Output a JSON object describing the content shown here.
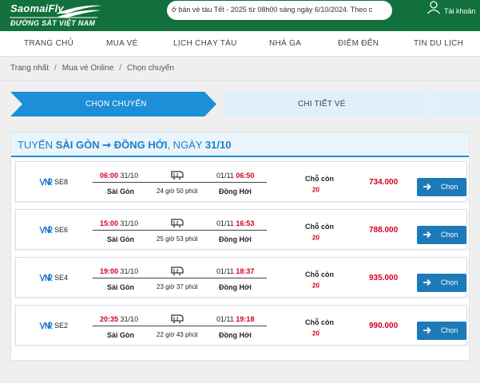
{
  "header": {
    "logo_text": "SaomaiFly",
    "logo_subtext": "ĐƯỜNG SẮT VIỆT NAM",
    "ticker": "ở bán vé tàu Tết - 2025 từ 08h00 sáng ngày 6/10/2024. Theo c",
    "account_label": "Tài khoản",
    "brand_color": "#11703c"
  },
  "nav": {
    "items": [
      "TRANG CHỦ",
      "MUA VÉ",
      "LỊCH CHẠY TÀU",
      "NHÀ GA",
      "ĐIỂM ĐẾN",
      "TIN DU LỊCH"
    ]
  },
  "breadcrumb": [
    "Trang nhất",
    "Mua vé Online",
    "Chọn chuyến"
  ],
  "steps": [
    "CHỌN CHUYẾN",
    "CHI TIẾT VÉ"
  ],
  "route": {
    "prefix": "TUYẾN",
    "from": "SÀI GÒN",
    "arrow": "➞",
    "to": "ĐỒNG HỚI",
    "date_prefix": ", NGÀY",
    "date": "31/10"
  },
  "trips": [
    {
      "code": "SE8",
      "dep_time": "06:00",
      "dep_date": "31/10",
      "arr_date": "01/11",
      "arr_time": "06:50",
      "dep_station": "Sài Gòn",
      "arr_station": "Đồng Hới",
      "duration": "24 giờ 50 phút",
      "seat_label": "Chỗ còn",
      "seats": "20",
      "price": "734.000",
      "button": "Chọn"
    },
    {
      "code": "SE6",
      "dep_time": "15:00",
      "dep_date": "31/10",
      "arr_date": "01/11",
      "arr_time": "16:53",
      "dep_station": "Sài Gòn",
      "arr_station": "Đồng Hới",
      "duration": "25 giờ 53 phút",
      "seat_label": "Chỗ còn",
      "seats": "20",
      "price": "788.000",
      "button": "Chọn"
    },
    {
      "code": "SE4",
      "dep_time": "19:00",
      "dep_date": "31/10",
      "arr_date": "01/11",
      "arr_time": "18:37",
      "dep_station": "Sài Gòn",
      "arr_station": "Đồng Hới",
      "duration": "23 giờ 37 phút",
      "seat_label": "Chỗ còn",
      "seats": "20",
      "price": "935.000",
      "button": "Chọn"
    },
    {
      "code": "SE2",
      "dep_time": "20:35",
      "dep_date": "31/10",
      "arr_date": "01/11",
      "arr_time": "19:18",
      "dep_station": "Sài Gòn",
      "arr_station": "Đồng Hới",
      "duration": "22 giờ 43 phút",
      "seat_label": "Chỗ còn",
      "seats": "20",
      "price": "990.000",
      "button": "Chọn"
    }
  ],
  "icons": {
    "account": "user-icon",
    "train": "train-icon",
    "button_arrow": "arrow-right-icon"
  }
}
